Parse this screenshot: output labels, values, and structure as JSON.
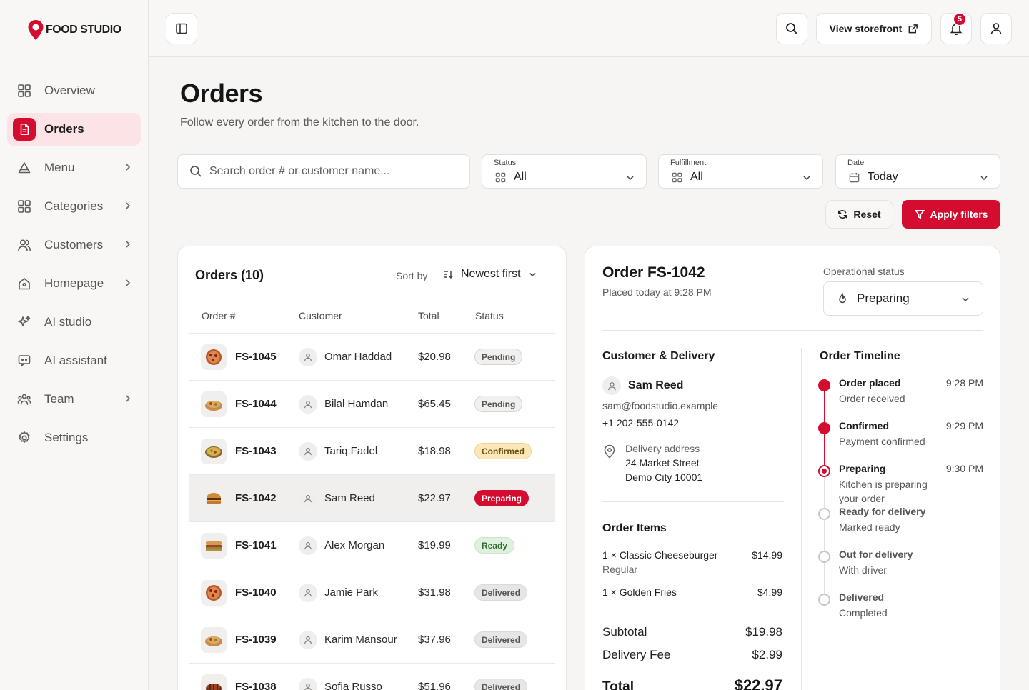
{
  "brand": {
    "name": "FOOD STUDIO",
    "accent": "#d40c2f"
  },
  "sidebar": {
    "items": [
      {
        "label": "Overview",
        "icon": "grid-icon",
        "chevron": false,
        "active": false
      },
      {
        "label": "Orders",
        "icon": "document-icon",
        "chevron": false,
        "active": true
      },
      {
        "label": "Menu",
        "icon": "menu-food-icon",
        "chevron": true,
        "active": false
      },
      {
        "label": "Categories",
        "icon": "grid-icon",
        "chevron": true,
        "active": false
      },
      {
        "label": "Customers",
        "icon": "users-icon",
        "chevron": true,
        "active": false
      },
      {
        "label": "Homepage",
        "icon": "home-icon",
        "chevron": true,
        "active": false
      },
      {
        "label": "AI studio",
        "icon": "sparkles-icon",
        "chevron": false,
        "active": false
      },
      {
        "label": "AI assistant",
        "icon": "chat-bot-icon",
        "chevron": false,
        "active": false
      },
      {
        "label": "Team",
        "icon": "team-icon",
        "chevron": true,
        "active": false
      },
      {
        "label": "Settings",
        "icon": "gear-icon",
        "chevron": false,
        "active": false
      }
    ]
  },
  "topbar": {
    "storefront_label": "View storefront",
    "notification_count": "5"
  },
  "page": {
    "title": "Orders",
    "subtitle": "Follow every order from the kitchen to the door."
  },
  "filters": {
    "search_placeholder": "Search order # or customer name...",
    "status": {
      "label": "Status",
      "value": "All"
    },
    "fulfillment": {
      "label": "Fulfillment",
      "value": "All"
    },
    "date": {
      "label": "Date",
      "value": "Today"
    },
    "reset_label": "Reset",
    "apply_label": "Apply filters"
  },
  "orders": {
    "title": "Orders (10)",
    "sort_label": "Sort by",
    "sort_value": "Newest first",
    "columns": [
      "Order #",
      "Customer",
      "Total",
      "Status"
    ],
    "rows": [
      {
        "id": "FS-1045",
        "customer": "Omar Haddad",
        "total": "$20.98",
        "status": "Pending",
        "food": "pizza"
      },
      {
        "id": "FS-1044",
        "customer": "Bilal Hamdan",
        "total": "$65.45",
        "status": "Pending",
        "food": "platter"
      },
      {
        "id": "FS-1043",
        "customer": "Tariq Fadel",
        "total": "$18.98",
        "status": "Confirmed",
        "food": "salad"
      },
      {
        "id": "FS-1042",
        "customer": "Sam Reed",
        "total": "$22.97",
        "status": "Preparing",
        "food": "burger",
        "selected": true
      },
      {
        "id": "FS-1041",
        "customer": "Alex Morgan",
        "total": "$19.99",
        "status": "Ready",
        "food": "sandwich"
      },
      {
        "id": "FS-1040",
        "customer": "Jamie Park",
        "total": "$31.98",
        "status": "Delivered",
        "food": "pizza"
      },
      {
        "id": "FS-1039",
        "customer": "Karim Mansour",
        "total": "$37.96",
        "status": "Delivered",
        "food": "platter"
      },
      {
        "id": "FS-1038",
        "customer": "Sofia Russo",
        "total": "$51.96",
        "status": "Delivered",
        "food": "ribs"
      }
    ]
  },
  "detail": {
    "title": "Order FS-1042",
    "placed": "Placed today at 9:28 PM",
    "op_status_label": "Operational status",
    "op_status_value": "Preparing",
    "customer_heading": "Customer & Delivery",
    "customer": {
      "name": "Sam Reed",
      "email": "sam@foodstudio.example",
      "phone": "+1 202-555-0142",
      "address_label": "Delivery address",
      "address_line1": "24 Market Street",
      "address_line2": "Demo City 10001"
    },
    "items_heading": "Order Items",
    "items": [
      {
        "name": "1 × Classic Cheeseburger",
        "variant": "Regular",
        "price": "$14.99"
      },
      {
        "name": "1 × Golden Fries",
        "variant": "",
        "price": "$4.99"
      }
    ],
    "subtotal_label": "Subtotal",
    "subtotal": "$19.98",
    "delivery_fee_label": "Delivery Fee",
    "delivery_fee": "$2.99",
    "total_label": "Total",
    "total": "$22.97",
    "timeline_heading": "Order Timeline",
    "timeline": [
      {
        "label": "Order placed",
        "desc": "Order received",
        "time": "9:28 PM",
        "state": "done"
      },
      {
        "label": "Confirmed",
        "desc": "Payment confirmed",
        "time": "9:29 PM",
        "state": "done"
      },
      {
        "label": "Preparing",
        "desc": "Kitchen is preparing your order",
        "time": "9:30 PM",
        "state": "current"
      },
      {
        "label": "Ready for delivery",
        "desc": "Marked ready",
        "time": "",
        "state": "pending"
      },
      {
        "label": "Out for delivery",
        "desc": "With driver",
        "time": "",
        "state": "pending"
      },
      {
        "label": "Delivered",
        "desc": "Completed",
        "time": "",
        "state": "pending"
      }
    ]
  }
}
